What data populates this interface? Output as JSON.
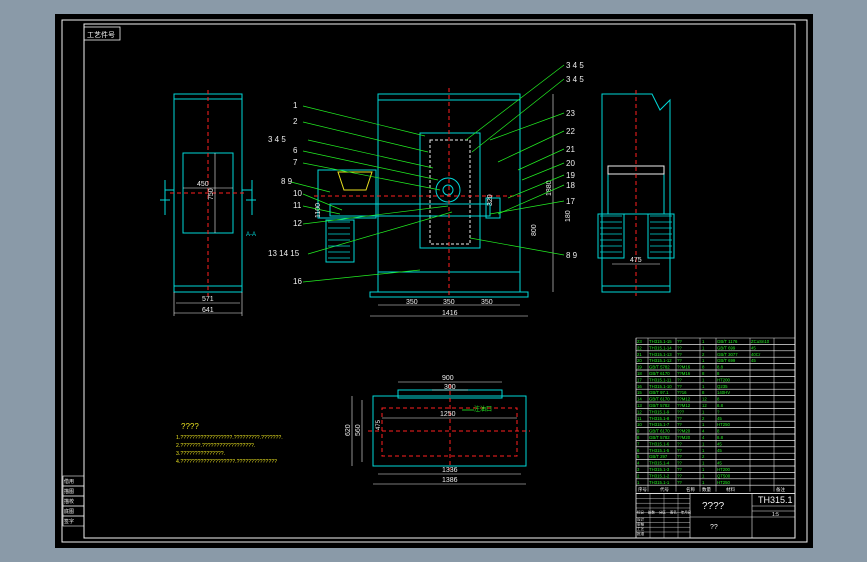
{
  "colors": {
    "outer_bg": "#8a9aa8",
    "sheet": "#000000",
    "frame": "#f2f2f2",
    "outline": "#00d8d8",
    "leader": "#22ee22",
    "hidden": "#ff2020",
    "dim": "#eeeeee",
    "yellow": "#e8e020"
  },
  "sheet_tag": "工艺件号",
  "part_labels": [
    "1",
    "2",
    "3 4 5",
    "6",
    "7",
    "8 9",
    "10",
    "11",
    "12",
    "13 14 15",
    "16",
    "3 4 5",
    "3 4 5",
    "23",
    "22",
    "21",
    "20",
    "19",
    "18",
    "17",
    "8 9"
  ],
  "dims": {
    "left_view": [
      "450",
      "750",
      "571",
      "641",
      "A-A"
    ],
    "front_view": [
      "350",
      "350",
      "350",
      "1416",
      "1880",
      "1100",
      "800",
      "320",
      "180"
    ],
    "right_view": [
      "475"
    ],
    "plan_view": [
      "900",
      "300",
      "1250",
      "1336",
      "1386",
      "620",
      "560",
      "475",
      "注油口"
    ]
  },
  "notes": {
    "title": "????",
    "lines": [
      "1.??????????????????.?????????.???????.",
      "2.???????.??????????????????.",
      "3.???????????????.",
      "4.???????????????????.??????????????"
    ]
  },
  "title_block": {
    "drawing_no": "TH315.1",
    "name": "????",
    "scale": "1:5",
    "org": "??",
    "bom_header": [
      "序号",
      "代号",
      "名称",
      "数量",
      "材料",
      "备注"
    ],
    "bom_rows": [
      [
        "23",
        "TH315.1-15",
        "??",
        "1",
        "GB/T 1176",
        "ZCuSn10"
      ],
      [
        "22",
        "TH315.1-14",
        "??",
        "1",
        "GB/T 699",
        "45"
      ],
      [
        "21",
        "TH315.1-13",
        "??",
        "2",
        "GB/T 3077",
        "40Cr"
      ],
      [
        "20",
        "TH315.1-12",
        "??",
        "1",
        "GB/T 699",
        "45"
      ],
      [
        "19",
        "GB/T 5782",
        "??M16",
        "8",
        "8.8",
        ""
      ],
      [
        "18",
        "GB/T 6170",
        "??M16",
        "8",
        "8",
        ""
      ],
      [
        "17",
        "TH315.1-11",
        "??",
        "1",
        "HT200",
        ""
      ],
      [
        "16",
        "TH315.1-10",
        "??",
        "1",
        "Q235",
        ""
      ],
      [
        "15",
        "GB/T 97.1",
        "??16",
        "8",
        "140HV",
        ""
      ],
      [
        "14",
        "GB/T 6170",
        "??M12",
        "12",
        "8",
        ""
      ],
      [
        "13",
        "GB/T 5782",
        "??M12",
        "12",
        "8.8",
        ""
      ],
      [
        "12",
        "TH315.1-9",
        "???",
        "1",
        "?",
        ""
      ],
      [
        "11",
        "TH315.1-8",
        "??",
        "2",
        "45",
        ""
      ],
      [
        "10",
        "TH315.1-7",
        "??",
        "1",
        "HT250",
        ""
      ],
      [
        "9",
        "GB/T 6170",
        "??M20",
        "4",
        "8",
        ""
      ],
      [
        "8",
        "GB/T 5782",
        "??M20",
        "4",
        "8.8",
        ""
      ],
      [
        "7",
        "TH315.1-6",
        "??",
        "1",
        "45",
        ""
      ],
      [
        "6",
        "TH315.1-5",
        "??",
        "1",
        "45",
        ""
      ],
      [
        "5",
        "GB/T 297",
        "??",
        "2",
        "",
        ""
      ],
      [
        "4",
        "TH315.1-4",
        "??",
        "1",
        "45",
        ""
      ],
      [
        "3",
        "TH315.1-3",
        "??",
        "1",
        "HT200",
        ""
      ],
      [
        "2",
        "TH315.1-2",
        "??",
        "1",
        "QT500",
        ""
      ],
      [
        "1",
        "TH315.1-1",
        "??",
        "1",
        "HT250",
        ""
      ]
    ],
    "sign_rows": [
      [
        "设计",
        "",
        "",
        ""
      ],
      [
        "审核",
        "",
        "",
        ""
      ],
      [
        "工艺",
        "",
        "",
        ""
      ],
      [
        "批准",
        "",
        "",
        ""
      ]
    ],
    "small_cells": [
      "标记",
      "处数",
      "分区",
      "签名",
      "年月日"
    ],
    "left_strip": [
      "借用",
      "描图",
      "描校",
      "底图",
      "签字"
    ]
  }
}
